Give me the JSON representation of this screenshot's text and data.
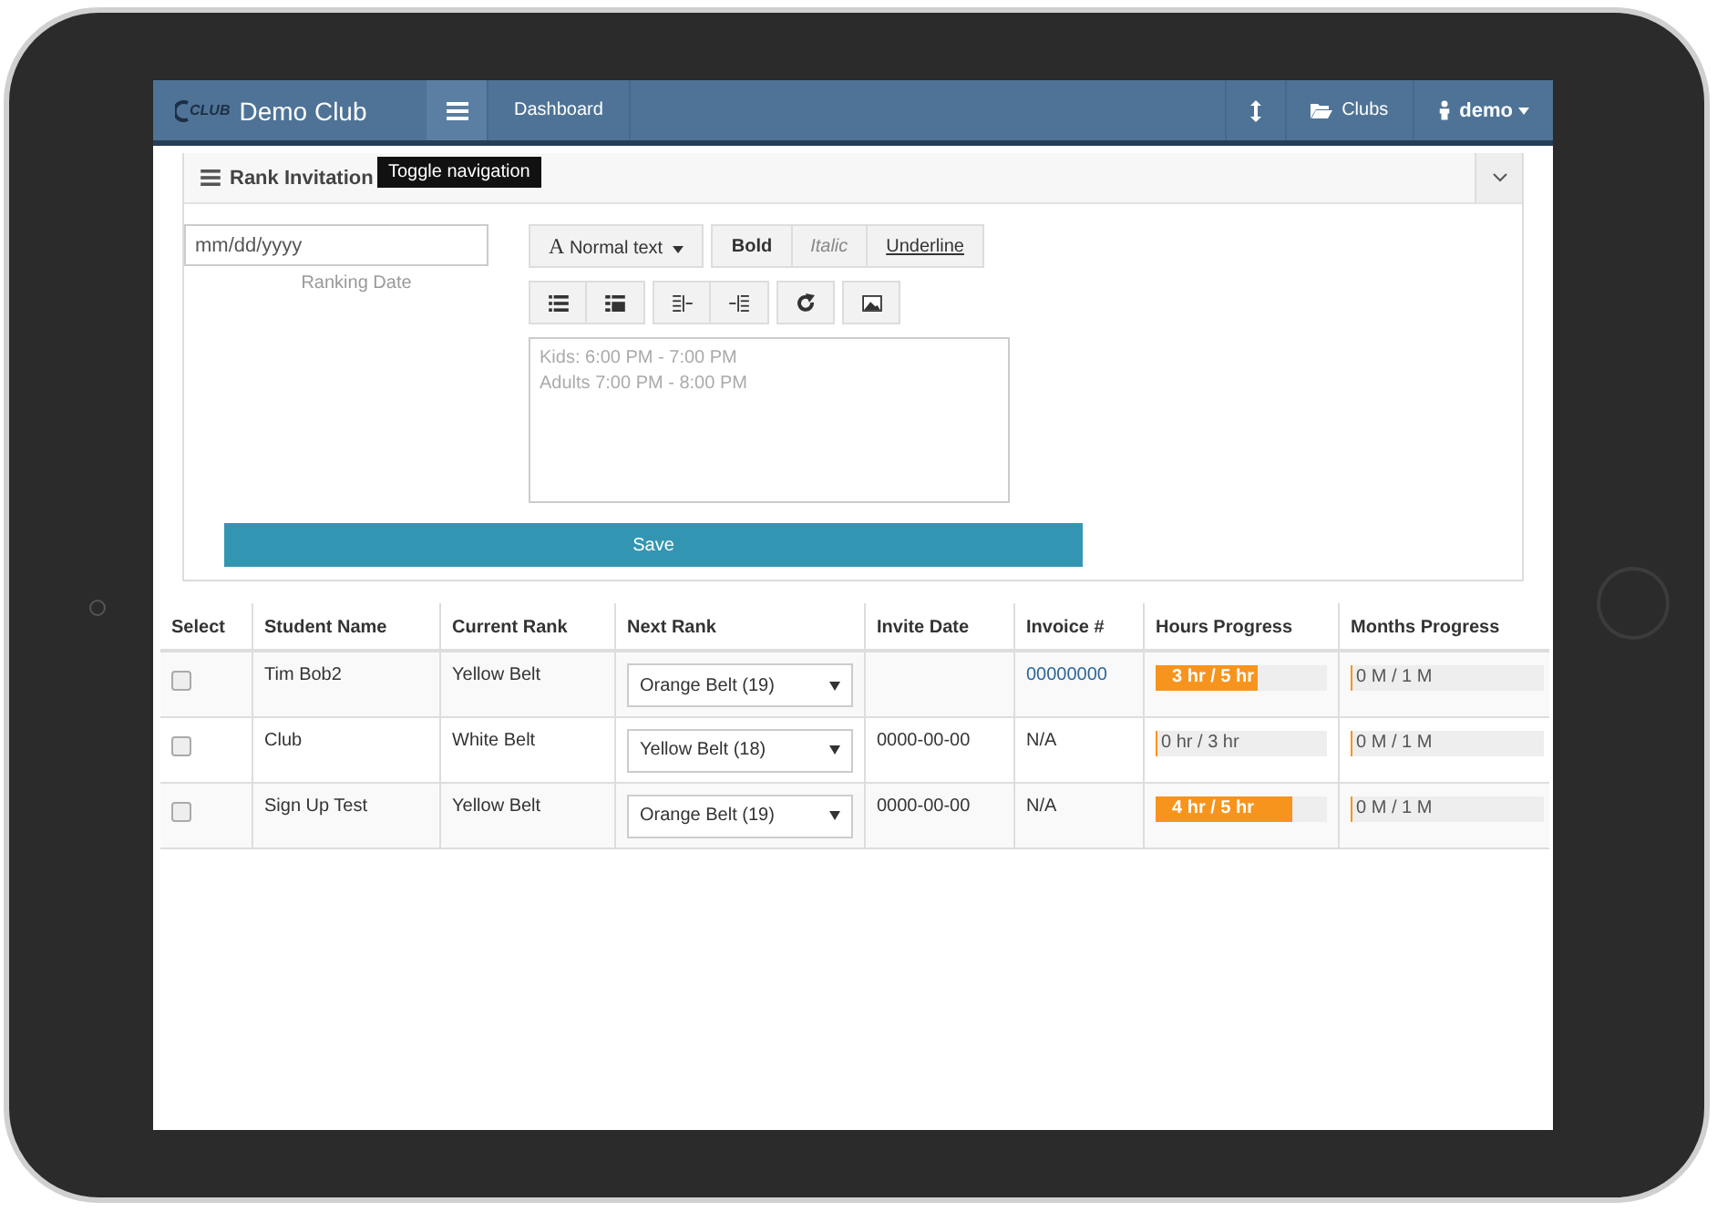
{
  "navbar": {
    "logo": "CLUB",
    "brand": "Demo Club",
    "toggle_tooltip": "Toggle navigation",
    "links": [
      {
        "label": "Dashboard"
      }
    ],
    "right": [
      {
        "kind": "resize"
      },
      {
        "kind": "folder",
        "label": "Clubs"
      },
      {
        "kind": "user",
        "label": "demo"
      }
    ]
  },
  "panel": {
    "title": "Rank Invitation",
    "date_field": {
      "placeholder": "mm/dd/yyyy",
      "label": "Ranking Date"
    },
    "editor": {
      "style_icon": "A",
      "style_menu": "Normal text",
      "format_buttons": [
        {
          "label": "Bold",
          "kind": "bold"
        },
        {
          "label": "Italic",
          "kind": "italic"
        },
        {
          "label": "Underline",
          "kind": "underline"
        }
      ],
      "tool_groups": [
        {
          "tools": [
            {
              "kind": "bullet-list"
            },
            {
              "kind": "number-list"
            }
          ]
        },
        {
          "tools": [
            {
              "kind": "outdent"
            },
            {
              "kind": "indent"
            }
          ]
        },
        {
          "tools": [
            {
              "kind": "undo"
            }
          ]
        },
        {
          "tools": [
            {
              "kind": "image"
            }
          ]
        }
      ],
      "lines": [
        "Kids: 6:00 PM - 7:00 PM",
        "Adults 7:00 PM - 8:00 PM"
      ]
    },
    "save": "Save"
  },
  "table": {
    "columns": [
      "Select",
      "Student Name",
      "Current Rank",
      "Next Rank",
      "Invite Date",
      "Invoice #",
      "Hours Progress",
      "Months Progress"
    ],
    "rows": [
      {
        "checked": false,
        "name": "Tim Bob2",
        "current_rank": "Yellow Belt",
        "next_rank": "Orange Belt (19)",
        "invite_date": "",
        "invoice": "00000000",
        "invoice_link": true,
        "hours": {
          "text": "3 hr / 5 hr",
          "level": 0.6
        },
        "months": {
          "text": "0 M / 1 M",
          "level": 0
        }
      },
      {
        "checked": false,
        "name": "Club",
        "current_rank": "White Belt",
        "next_rank": "Yellow Belt (18)",
        "invite_date": "0000-00-00",
        "invoice": "N/A",
        "invoice_link": false,
        "hours": {
          "text": "0 hr / 3 hr",
          "level": 0
        },
        "months": {
          "text": "0 M / 1 M",
          "level": 0
        }
      },
      {
        "checked": false,
        "name": "Sign Up Test",
        "current_rank": "Yellow Belt",
        "next_rank": "Orange Belt (19)",
        "invite_date": "0000-00-00",
        "invoice": "N/A",
        "invoice_link": false,
        "hours": {
          "text": "4 hr / 5 hr",
          "level": 0.8
        },
        "months": {
          "text": "0 M / 1 M",
          "level": 0
        }
      }
    ]
  }
}
